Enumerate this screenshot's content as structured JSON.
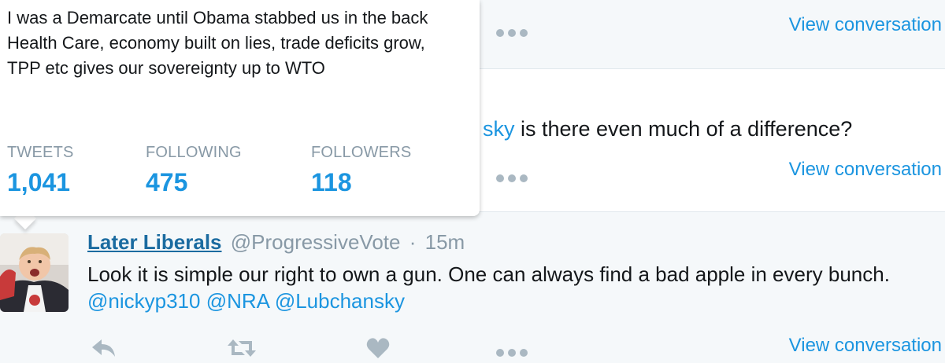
{
  "profile_card": {
    "bio": "I was a Demarcate until Obama stabbed us in the back Health Care, economy built on lies, trade deficits grow, TPP etc gives our sovereignty up to WTO",
    "stats": {
      "tweets_label": "TWEETS",
      "tweets_value": "1,041",
      "following_label": "FOLLOWING",
      "following_value": "475",
      "followers_label": "FOLLOWERS",
      "followers_value": "118"
    }
  },
  "row1": {
    "view_conversation": "View conversation"
  },
  "row2": {
    "text_mention_fragment": "sky",
    "text_rest": " is there even much of a difference?",
    "view_conversation": "View conversation"
  },
  "row3": {
    "display_name": "Later Liberals",
    "handle": "@ProgressiveVote",
    "separator": "·",
    "time": "15m",
    "text": "Look it is simple our right to own a gun. One can always find a bad apple in every bunch. ",
    "mentions": [
      "@nickyp310",
      "@NRA",
      "@Lubchansky"
    ],
    "view_conversation": "View conversation"
  },
  "icons": {
    "reply": "reply-icon",
    "retweet": "retweet-icon",
    "like": "heart-icon",
    "more": "more-icon"
  },
  "colors": {
    "link": "#1b95e0",
    "name": "#1b6ba0",
    "muted": "#8899a6",
    "icon": "#aab8c2",
    "stream_bg": "#f5f8fa"
  }
}
